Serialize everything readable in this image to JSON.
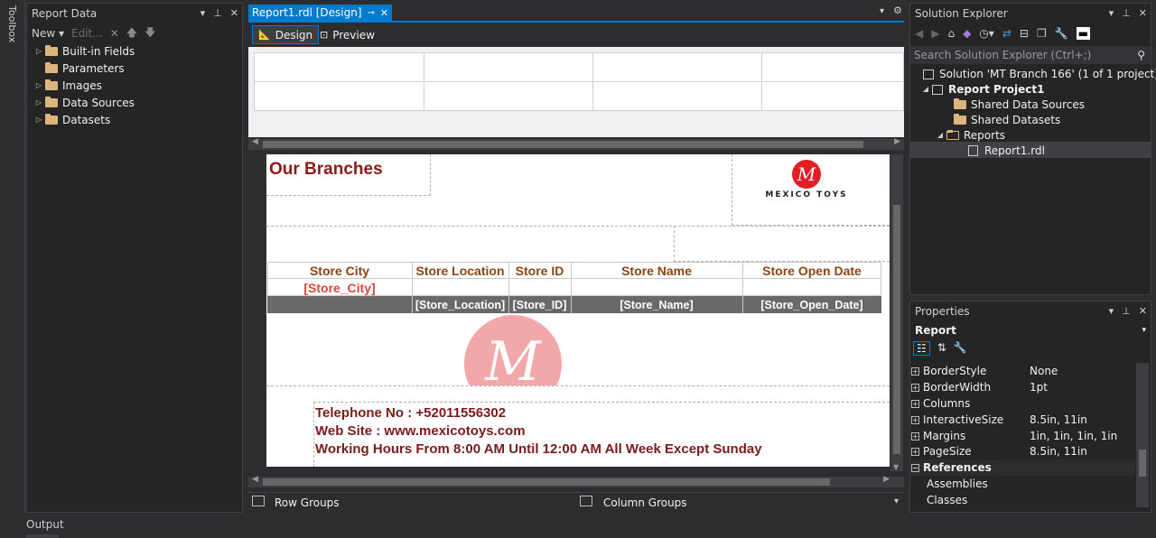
{
  "toolbox": {
    "label": "Toolbox"
  },
  "report_data": {
    "title": "Report Data",
    "toolbar": {
      "new": "New",
      "edit": "Edit..."
    },
    "items": [
      {
        "label": "Built-in Fields"
      },
      {
        "label": "Parameters"
      },
      {
        "label": "Images"
      },
      {
        "label": "Data Sources"
      },
      {
        "label": "Datasets"
      }
    ]
  },
  "designer": {
    "tab_label": "Report1.rdl [Design]",
    "design_label": "Design",
    "preview_label": "Preview"
  },
  "report": {
    "title": "Our Branches",
    "logo_text": "MEXICO TOYS",
    "logo_letter": "M",
    "headers": [
      "Store City",
      "Store Location",
      "Store ID",
      "Store Name",
      "Store Open Date"
    ],
    "group_field": "[Store_City]",
    "detail_fields": [
      "[Store_Location]",
      "[Store_ID]",
      "[Store_Name]",
      "[Store_Open_Date]"
    ],
    "watermark_letter": "M",
    "footer": {
      "telephone": "Telephone No : +52011556302",
      "website": "Web Site : www.mexicotoys.com",
      "hours": "Working Hours From 8:00 AM Until 12:00 AM All Week Except Sunday"
    }
  },
  "groups": {
    "row": "Row Groups",
    "column": "Column Groups"
  },
  "solution_explorer": {
    "title": "Solution Explorer",
    "search_placeholder": "Search Solution Explorer (Ctrl+;)",
    "solution": "Solution 'MT Branch 166' (1 of 1 project)",
    "project": "Report Project1",
    "shared_data_sources": "Shared Data Sources",
    "shared_datasets": "Shared Datasets",
    "reports": "Reports",
    "report_file": "Report1.rdl"
  },
  "properties": {
    "title": "Properties",
    "object": "Report",
    "rows": [
      {
        "name": "BorderStyle",
        "value": "None"
      },
      {
        "name": "BorderWidth",
        "value": "1pt"
      },
      {
        "name": "Columns",
        "value": ""
      },
      {
        "name": "InteractiveSize",
        "value": "8.5in, 11in"
      },
      {
        "name": "Margins",
        "value": "1in, 1in, 1in, 1in"
      },
      {
        "name": "PageSize",
        "value": "8.5in, 11in"
      }
    ],
    "category": "References",
    "sub_rows": [
      "Assemblies",
      "Classes"
    ]
  },
  "output": {
    "label": "Output"
  },
  "colors": {
    "accent": "#007acc",
    "title_red": "#8b1a1a",
    "header_brown": "#8b4513",
    "logo_red": "#e31e24"
  }
}
